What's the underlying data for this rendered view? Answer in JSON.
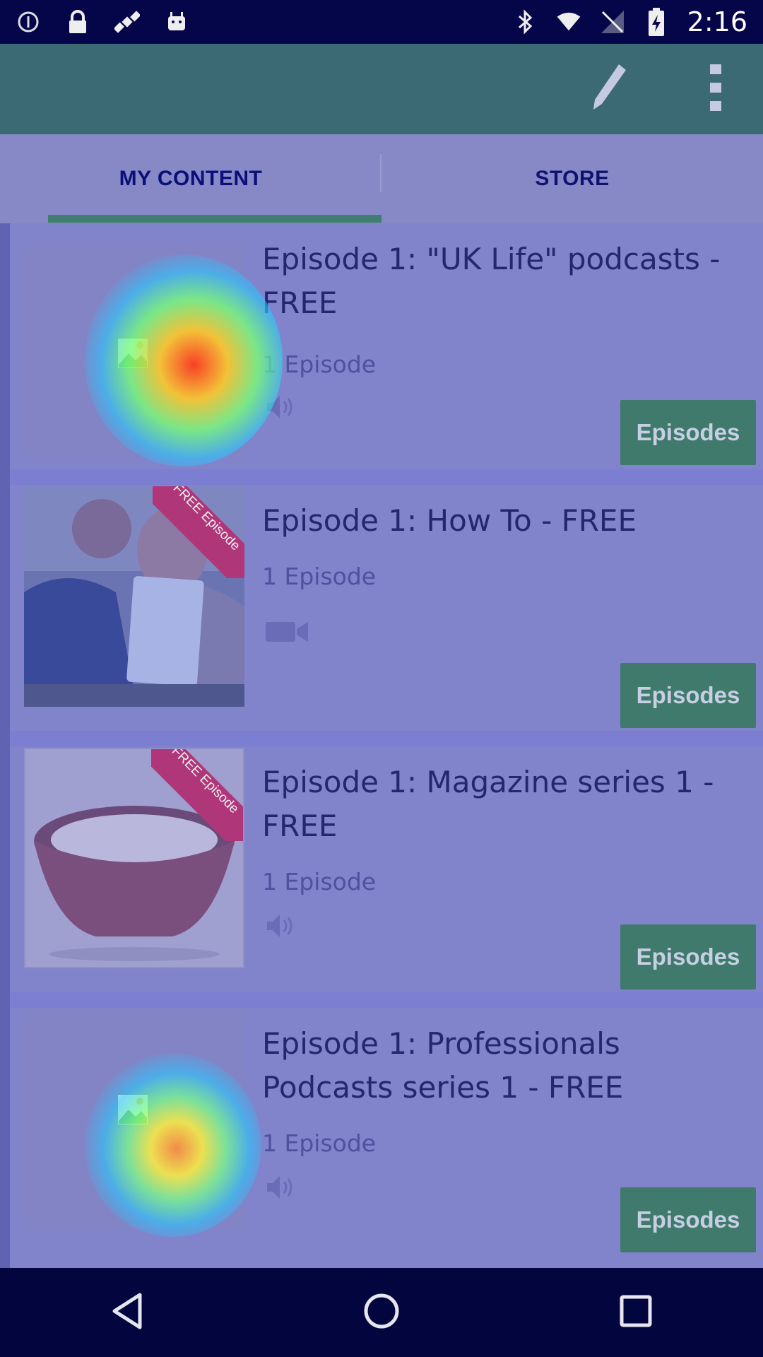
{
  "status_bar": {
    "time": "2:16",
    "left_icons": [
      "info-circle-icon",
      "lock-icon",
      "satellite-icon",
      "android-icon"
    ],
    "right_icons": [
      "bluetooth-icon",
      "wifi-icon",
      "no-signal-icon",
      "battery-charging-icon"
    ]
  },
  "app_bar": {
    "actions": [
      "edit-icon",
      "overflow-menu-icon"
    ]
  },
  "tabs": [
    {
      "label": "MY CONTENT",
      "active": true
    },
    {
      "label": "STORE",
      "active": false
    }
  ],
  "items": [
    {
      "title": "Episode 1: \"UK Life\" podcasts - FREE",
      "count": "1 Episode",
      "media": "audio",
      "button": "Episodes",
      "thumbnail": "broken-image"
    },
    {
      "title": "Episode 1: How To - FREE",
      "count": "1 Episode",
      "media": "video",
      "button": "Episodes",
      "thumbnail": "people-with-tablet",
      "ribbon": "FREE Episode"
    },
    {
      "title": "Episode 1: Magazine series 1 - FREE",
      "count": "1 Episode",
      "media": "audio",
      "button": "Episodes",
      "thumbnail": "bowl-of-rice",
      "ribbon": "FREE Episode"
    },
    {
      "title": "Episode 1: Professionals Podcasts series 1 - FREE",
      "count": "1 Episode",
      "media": "audio",
      "button": "Episodes",
      "thumbnail": "broken-image"
    }
  ],
  "nav_bar": [
    "back-icon",
    "home-icon",
    "recents-icon"
  ],
  "colors": {
    "app_bar": "#3b6a74",
    "tab_indicator": "#3f7f70",
    "episodes_button": "#3f7a6d",
    "ribbon": "#b0367a"
  }
}
